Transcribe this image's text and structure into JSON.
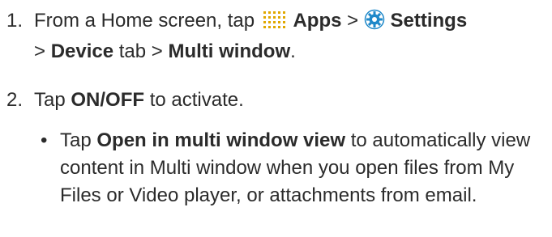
{
  "steps": [
    {
      "number": "1.",
      "intro": "From a Home screen, tap",
      "apps_label": "Apps",
      "sep1": ">",
      "settings_label": "Settings",
      "sep2": ">",
      "device_label": "Device",
      "tab_word": "tab",
      "sep3": ">",
      "multi_window_label": "Multi window",
      "end_punct": ".",
      "apps_icon": "apps-grid-icon",
      "settings_icon": "settings-gear-icon"
    },
    {
      "number": "2.",
      "tap_word": "Tap",
      "onoff_label": "ON/OFF",
      "rest": "to activate."
    }
  ],
  "bullet": {
    "symbol": "•",
    "tap_word": "Tap",
    "option_label": "Open in multi window view",
    "description": "to automatically view content in Multi window when you open files from My Files or Video player, or attachments from email."
  },
  "colors": {
    "text": "#2b2b2b",
    "apps_icon_dots": "#e0a800",
    "settings_icon": "#1e88c9"
  }
}
